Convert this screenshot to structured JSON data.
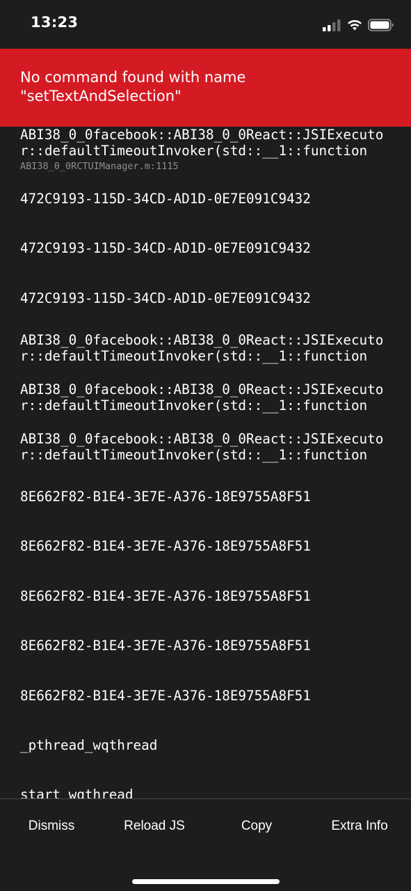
{
  "status_bar": {
    "time": "13:23"
  },
  "error": {
    "message": "No command found with name \"setTextAndSelection\""
  },
  "stack": [
    {
      "method": "ABI38_0_0facebook::ABI38_0_0React::JSIExecutor::defaultTimeoutInvoker(std::__1::function",
      "file": "ABI38_0_0RCTUIManager.m:1115"
    },
    {
      "method": "472C9193-115D-34CD-AD1D-0E7E091C9432",
      "file": ""
    },
    {
      "method": "472C9193-115D-34CD-AD1D-0E7E091C9432",
      "file": ""
    },
    {
      "method": "472C9193-115D-34CD-AD1D-0E7E091C9432",
      "file": ""
    },
    {
      "method": "ABI38_0_0facebook::ABI38_0_0React::JSIExecutor::defaultTimeoutInvoker(std::__1::function",
      "file": ""
    },
    {
      "method": "ABI38_0_0facebook::ABI38_0_0React::JSIExecutor::defaultTimeoutInvoker(std::__1::function",
      "file": ""
    },
    {
      "method": "ABI38_0_0facebook::ABI38_0_0React::JSIExecutor::defaultTimeoutInvoker(std::__1::function",
      "file": ""
    },
    {
      "method": "8E662F82-B1E4-3E7E-A376-18E9755A8F51",
      "file": ""
    },
    {
      "method": "8E662F82-B1E4-3E7E-A376-18E9755A8F51",
      "file": ""
    },
    {
      "method": "8E662F82-B1E4-3E7E-A376-18E9755A8F51",
      "file": ""
    },
    {
      "method": "8E662F82-B1E4-3E7E-A376-18E9755A8F51",
      "file": ""
    },
    {
      "method": "8E662F82-B1E4-3E7E-A376-18E9755A8F51",
      "file": ""
    },
    {
      "method": "_pthread_wqthread",
      "file": ""
    },
    {
      "method": "start_wqthread",
      "file": ""
    }
  ],
  "footer": {
    "dismiss_label": "Dismiss",
    "reload_label": "Reload JS",
    "copy_label": "Copy",
    "extra_info_label": "Extra Info"
  },
  "colors": {
    "banner": "#d41b24",
    "background": "#1d1d1d",
    "secondary_text": "#8e8e93"
  },
  "icons": [
    "cellular-signal-icon",
    "wifi-icon",
    "battery-icon"
  ]
}
